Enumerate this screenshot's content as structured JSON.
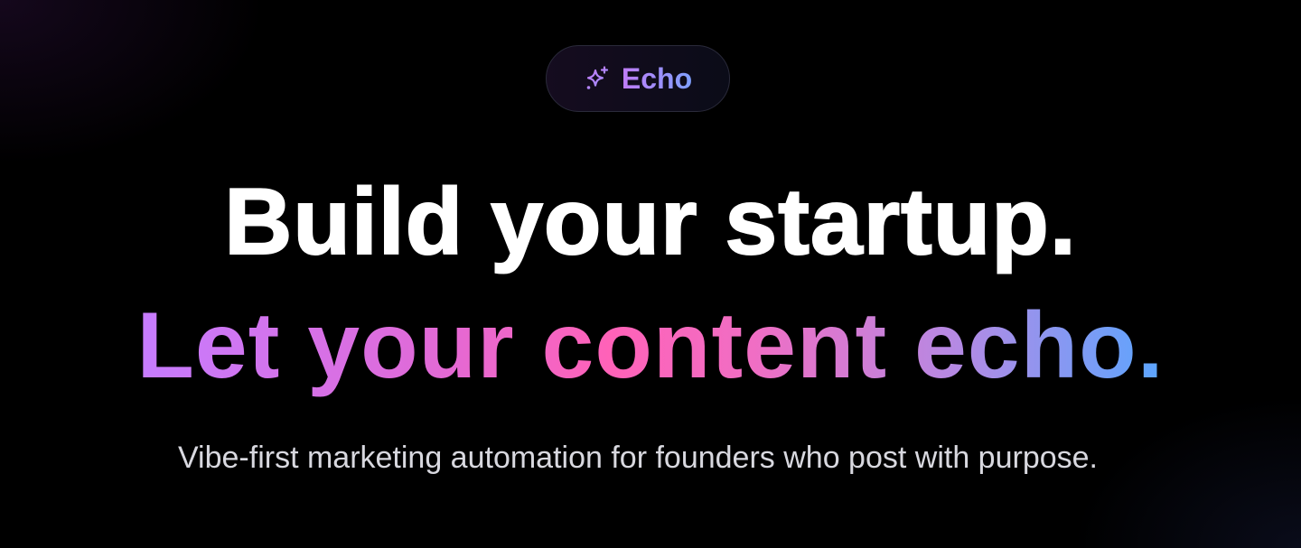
{
  "badge": {
    "label": "Echo",
    "icon": "sparkle-icon"
  },
  "hero": {
    "headline_line1": "Build your startup.",
    "headline_line2": "Let your content echo.",
    "subtitle": "Vibe-first marketing automation for founders who post with purpose."
  },
  "colors": {
    "background": "#000000",
    "headline": "#ffffff",
    "gradient_start": "#c67cff",
    "gradient_mid": "#ff62b8",
    "gradient_end": "#5aa6ff",
    "subtitle": "#d8d8df",
    "badge_border": "#2a2a3a"
  }
}
